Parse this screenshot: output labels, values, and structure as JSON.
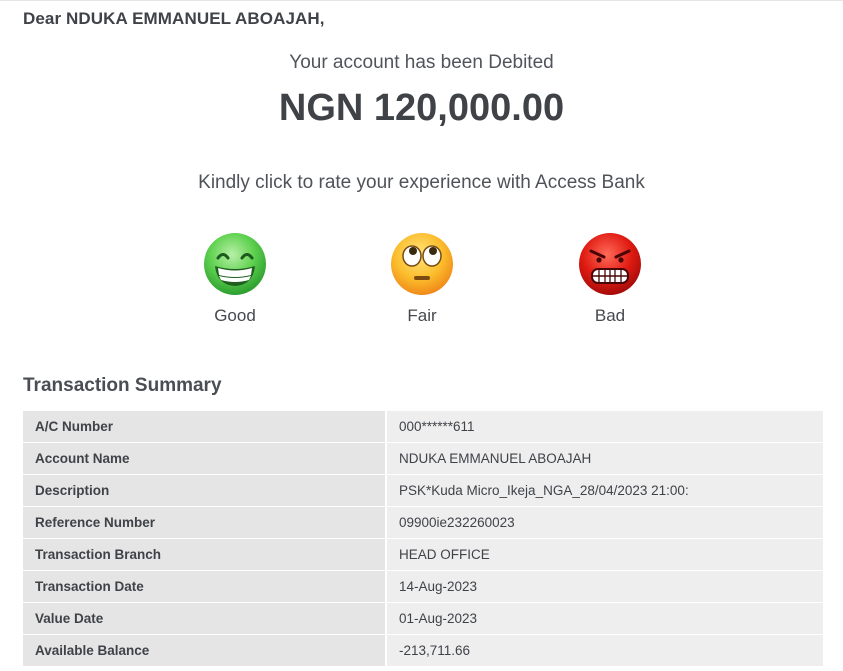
{
  "greeting": "Dear NDUKA EMMANUEL ABOAJAH,",
  "debit_message": "Your account has been Debited",
  "amount": "NGN 120,000.00",
  "rate_prompt": "Kindly click to rate your experience with Access Bank",
  "ratings": [
    {
      "label": "Good",
      "icon": "grinning-face-icon",
      "color": "#3fb53f"
    },
    {
      "label": "Fair",
      "icon": "eye-roll-face-icon",
      "color": "#f7a21e"
    },
    {
      "label": "Bad",
      "icon": "angry-face-icon",
      "color": "#d81414"
    }
  ],
  "summary": {
    "title": "Transaction Summary",
    "rows": [
      {
        "key": "A/C Number",
        "value": "000******611"
      },
      {
        "key": "Account Name",
        "value": "NDUKA EMMANUEL ABOAJAH"
      },
      {
        "key": "Description",
        "value": "PSK*Kuda Micro_Ikeja_NGA_28/04/2023 21:00:"
      },
      {
        "key": "Reference Number",
        "value": "09900ie232260023"
      },
      {
        "key": "Transaction Branch",
        "value": "HEAD OFFICE"
      },
      {
        "key": "Transaction Date",
        "value": "14-Aug-2023"
      },
      {
        "key": "Value Date",
        "value": "01-Aug-2023"
      },
      {
        "key": "Available Balance",
        "value": "-213,711.66"
      }
    ]
  }
}
